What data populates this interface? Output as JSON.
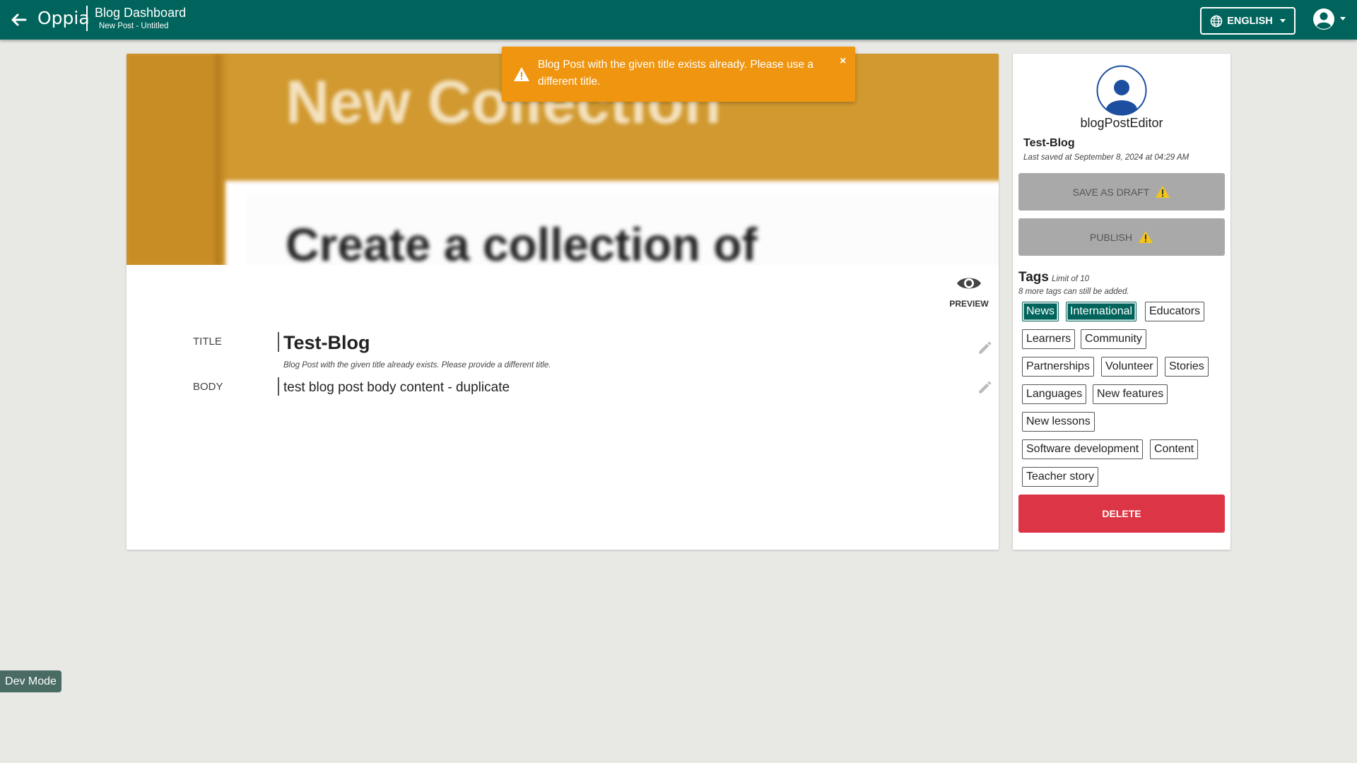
{
  "header": {
    "logo": "Oppia",
    "title": "Blog Dashboard",
    "subtitle": "New Post - Untitled",
    "language": "ENGLISH",
    "brand_color": "#00645c"
  },
  "thumbnail": {
    "line1": "New Collection",
    "line2": "Create a collection of"
  },
  "editor": {
    "preview_label": "PREVIEW",
    "title_label": "TITLE",
    "title_value": "Test-Blog",
    "title_error": "Blog Post with the given title already exists. Please provide a different title.",
    "body_label": "BODY",
    "body_value": "test blog post body content - duplicate"
  },
  "sidebar": {
    "author": "blogPostEditor",
    "post_title": "Test-Blog",
    "last_saved": "Last saved at September 8, 2024 at 04:29 AM",
    "save_draft_label": "SAVE AS DRAFT",
    "publish_label": "PUBLISH",
    "tags_heading": "Tags",
    "tags_limit": "Limit of 10",
    "tags_remaining": "8 more tags can still be added.",
    "tags": [
      {
        "label": "News",
        "selected": true
      },
      {
        "label": "International",
        "selected": true
      },
      {
        "label": "Educators",
        "selected": false
      },
      {
        "label": "Learners",
        "selected": false
      },
      {
        "label": "Community",
        "selected": false
      },
      {
        "label": "Partnerships",
        "selected": false
      },
      {
        "label": "Volunteer",
        "selected": false
      },
      {
        "label": "Stories",
        "selected": false
      },
      {
        "label": "Languages",
        "selected": false
      },
      {
        "label": "New features",
        "selected": false
      },
      {
        "label": "New lessons",
        "selected": false
      },
      {
        "label": "Software development",
        "selected": false
      },
      {
        "label": "Content",
        "selected": false
      },
      {
        "label": "Teacher story",
        "selected": false
      }
    ],
    "delete_label": "DELETE",
    "delete_color": "#dc3545"
  },
  "toast": {
    "message": "Blog Post with the given title exists already. Please use a different title.",
    "close": "×",
    "color": "#f0950f"
  },
  "dev_mode": "Dev Mode"
}
